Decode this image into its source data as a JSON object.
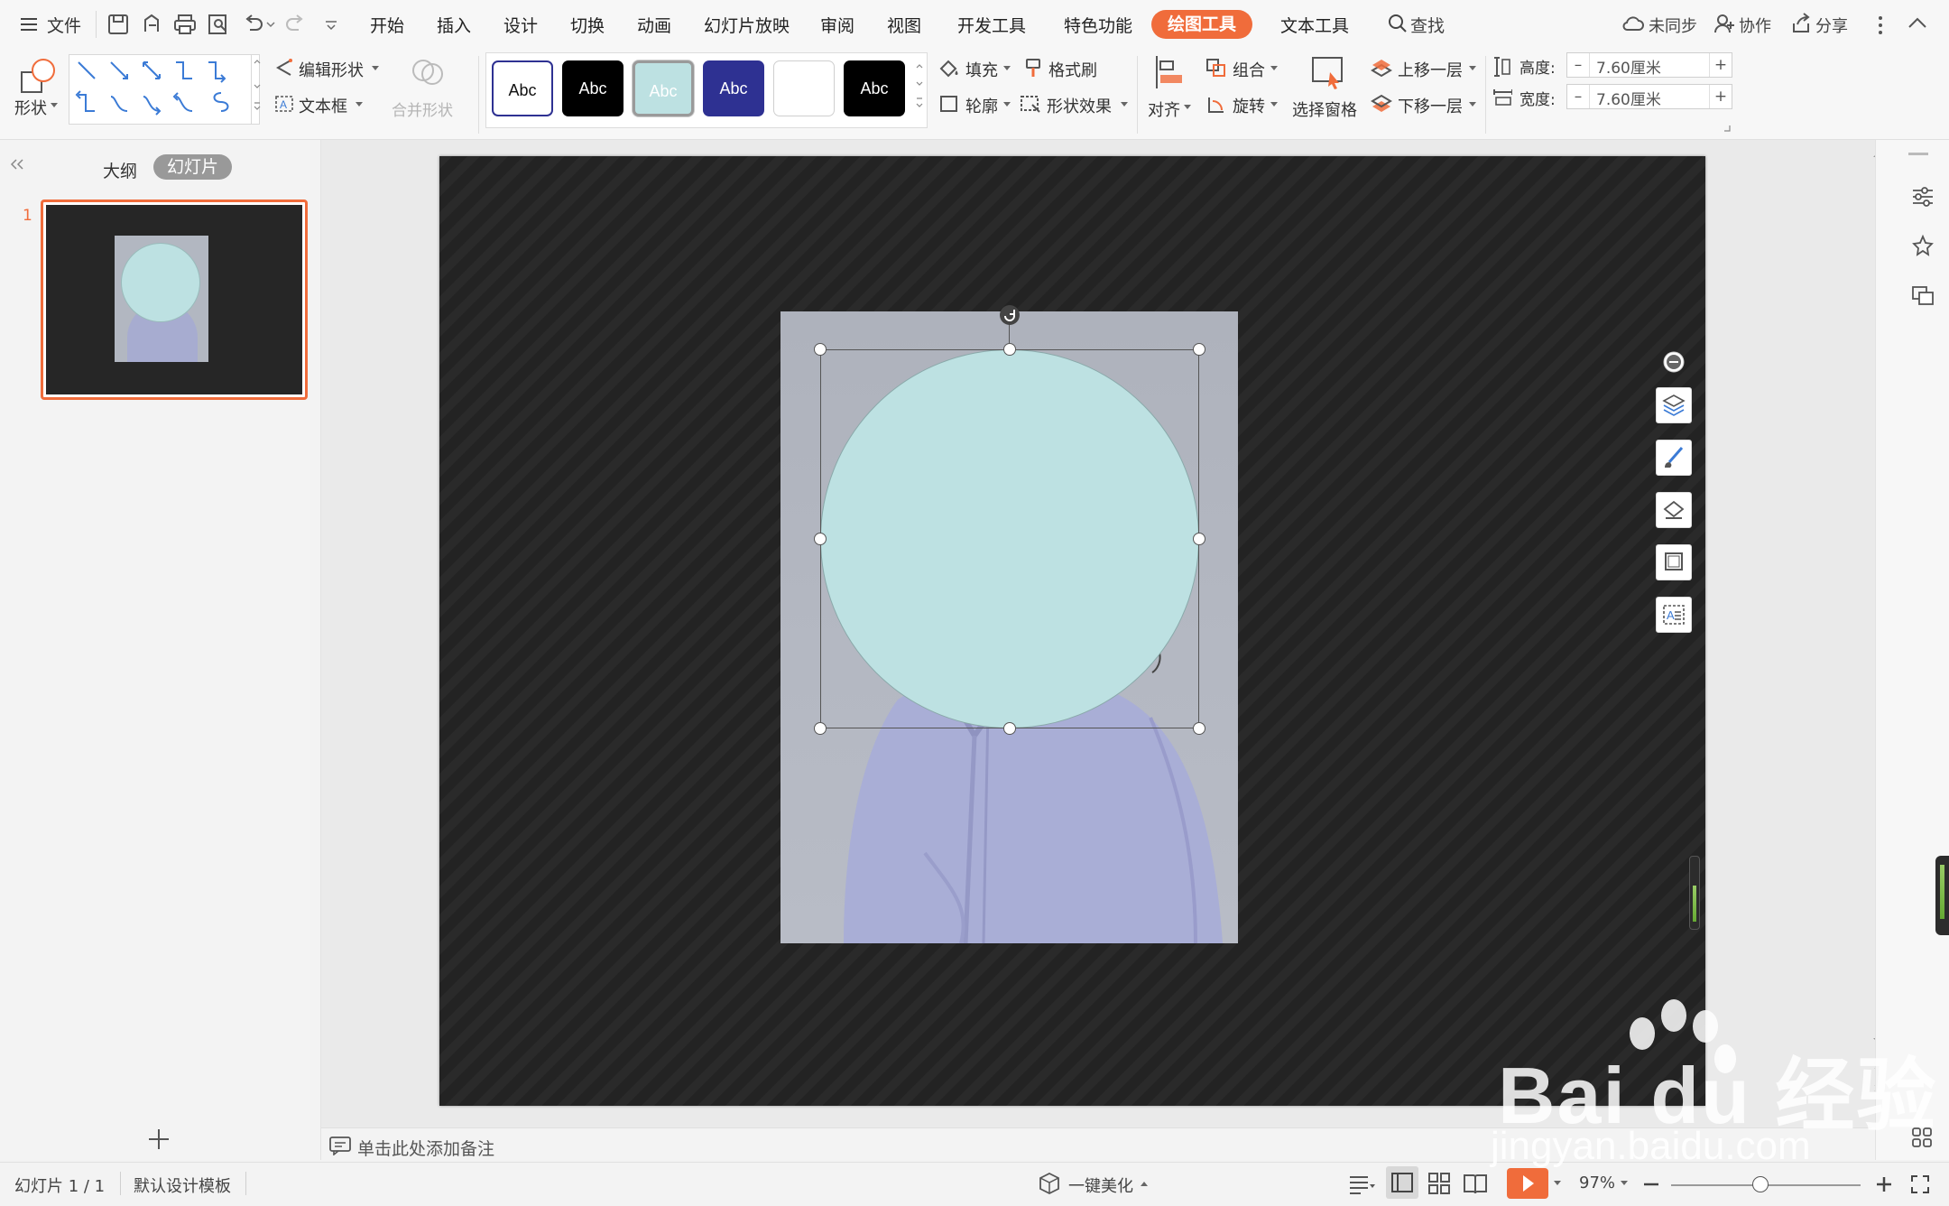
{
  "menubar": {
    "file": "文件",
    "tabs": [
      "开始",
      "插入",
      "设计",
      "切换",
      "动画",
      "幻灯片放映",
      "审阅",
      "视图",
      "开发工具",
      "特色功能",
      "绘图工具",
      "文本工具"
    ],
    "active_tab": "绘图工具",
    "search": "查找",
    "sync": "未同步",
    "collab": "协作",
    "share": "分享"
  },
  "ribbon": {
    "shape": "形状",
    "edit_shape": "编辑形状",
    "textbox": "文本框",
    "merge_shape": "合并形状",
    "style_samples": [
      "Abc",
      "Abc",
      "Abc",
      "Abc",
      "",
      "Abc"
    ],
    "fill": "填充",
    "format_painter": "格式刷",
    "outline": "轮廓",
    "shape_effect": "形状效果",
    "align": "对齐",
    "group": "组合",
    "rotate": "旋转",
    "selection_pane": "选择窗格",
    "bring_forward": "上移一层",
    "send_backward": "下移一层",
    "height_label": "高度:",
    "height_value": "7.60厘米",
    "width_label": "宽度:",
    "width_value": "7.60厘米"
  },
  "leftpane": {
    "outline_tab": "大纲",
    "slides_tab": "幻灯片",
    "slide_number": "1"
  },
  "notes": {
    "placeholder": "单击此处添加备注"
  },
  "status": {
    "slide_info": "幻灯片 1 / 1",
    "template": "默认设计模板",
    "beautify": "一键美化",
    "zoom": "97%"
  },
  "watermark": {
    "brand": "Bai du 经验",
    "url": "jingyan.baidu.com"
  },
  "colors": {
    "accent": "#f06c3b",
    "circle_fill": "#bde1e2",
    "slide_bg": "#252525",
    "photo_bg": "#b0b5bf",
    "style_navy": "#2e3192"
  }
}
